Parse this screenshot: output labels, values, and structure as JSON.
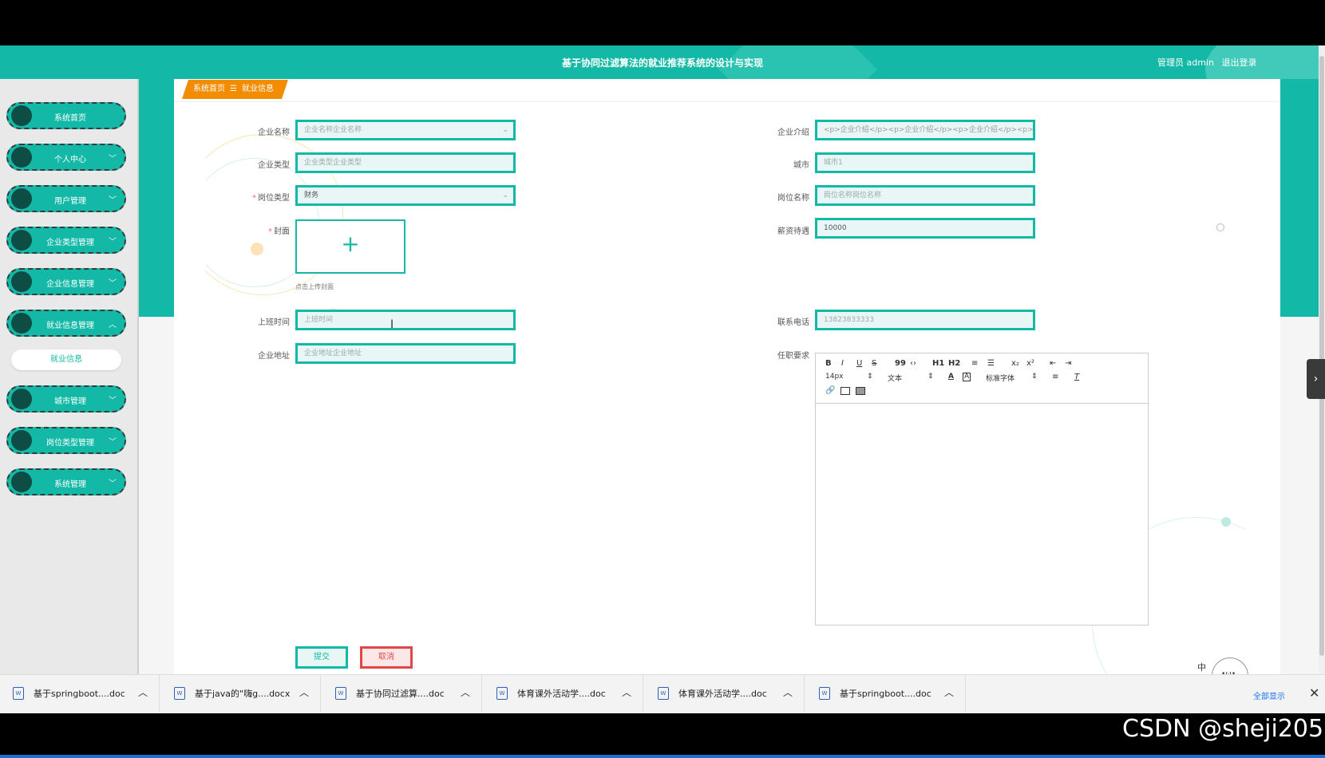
{
  "header": {
    "title": "基于协同过滤算法的就业推荐系统的设计与实现",
    "user_label": "管理员 admin",
    "logout_label": "退出登录"
  },
  "sidebar": {
    "items": [
      {
        "label": "系统首页",
        "has_chevron": false
      },
      {
        "label": "个人中心",
        "has_chevron": true
      },
      {
        "label": "用户管理",
        "has_chevron": true
      },
      {
        "label": "企业类型管理",
        "has_chevron": true
      },
      {
        "label": "企业信息管理",
        "has_chevron": true
      },
      {
        "label": "就业信息管理",
        "has_chevron": true,
        "expanded": true
      },
      {
        "label": "城市管理",
        "has_chevron": true
      },
      {
        "label": "岗位类型管理",
        "has_chevron": true
      },
      {
        "label": "系统管理",
        "has_chevron": true
      }
    ],
    "submenu": {
      "label": "就业信息"
    }
  },
  "breadcrumb": {
    "home": "系统首页",
    "separator": "☰",
    "current": "就业信息"
  },
  "form": {
    "left": [
      {
        "label": "企业名称",
        "placeholder": "企业名称企业名称",
        "type": "select"
      },
      {
        "label": "企业类型",
        "placeholder": "企业类型企业类型",
        "type": "input"
      },
      {
        "label": "岗位类型",
        "value": "财务",
        "type": "select",
        "required": true
      },
      {
        "label": "封面",
        "required": true,
        "type": "upload",
        "hint": "点击上传封面"
      },
      {
        "label": "上班时间",
        "placeholder": "上班时间",
        "type": "input"
      },
      {
        "label": "企业地址",
        "placeholder": "企业地址企业地址",
        "type": "input"
      }
    ],
    "right": [
      {
        "label": "企业介绍",
        "value": "<p>企业介绍</p><p>企业介绍</p><p>企业介绍</p><p>企业",
        "type": "input"
      },
      {
        "label": "城市",
        "value": "城市1",
        "type": "input"
      },
      {
        "label": "岗位名称",
        "placeholder": "岗位名称岗位名称",
        "type": "input"
      },
      {
        "label": "薪资待遇",
        "value": "10000",
        "type": "input"
      },
      {
        "label": "联系电话",
        "value": "13823833333",
        "type": "input"
      },
      {
        "label": "任职要求",
        "type": "editor"
      }
    ],
    "editor_toolbar": {
      "row1": [
        "B",
        "I",
        "U",
        "S",
        "99",
        "‹›",
        "H1",
        "H2",
        "≡",
        "☰",
        "x₂",
        "x²",
        "⇤",
        "⇥"
      ],
      "font_size": "14px",
      "text_style": "文本",
      "font_family": "标准字体"
    },
    "submit_label": "提交",
    "cancel_label": "取消"
  },
  "downloads": [
    {
      "name": "基于springboot....doc"
    },
    {
      "name": "基于java的\"嗨g....docx"
    },
    {
      "name": "基于协同过滤算....doc"
    },
    {
      "name": "体育课外活动学....doc"
    },
    {
      "name": "体育课外活动学....doc"
    },
    {
      "name": "基于springboot....doc"
    }
  ],
  "taskbar": {
    "show_all_label": "全部显示",
    "close_glyph": "✕"
  },
  "mascot_text": "中 。 简",
  "watermark": "CSDN @sheji205",
  "colors": {
    "accent": "#14b8a6",
    "breadcrumb": "#f28c00",
    "danger": "#e04848",
    "sidebar_dot": "#0d4d45"
  }
}
